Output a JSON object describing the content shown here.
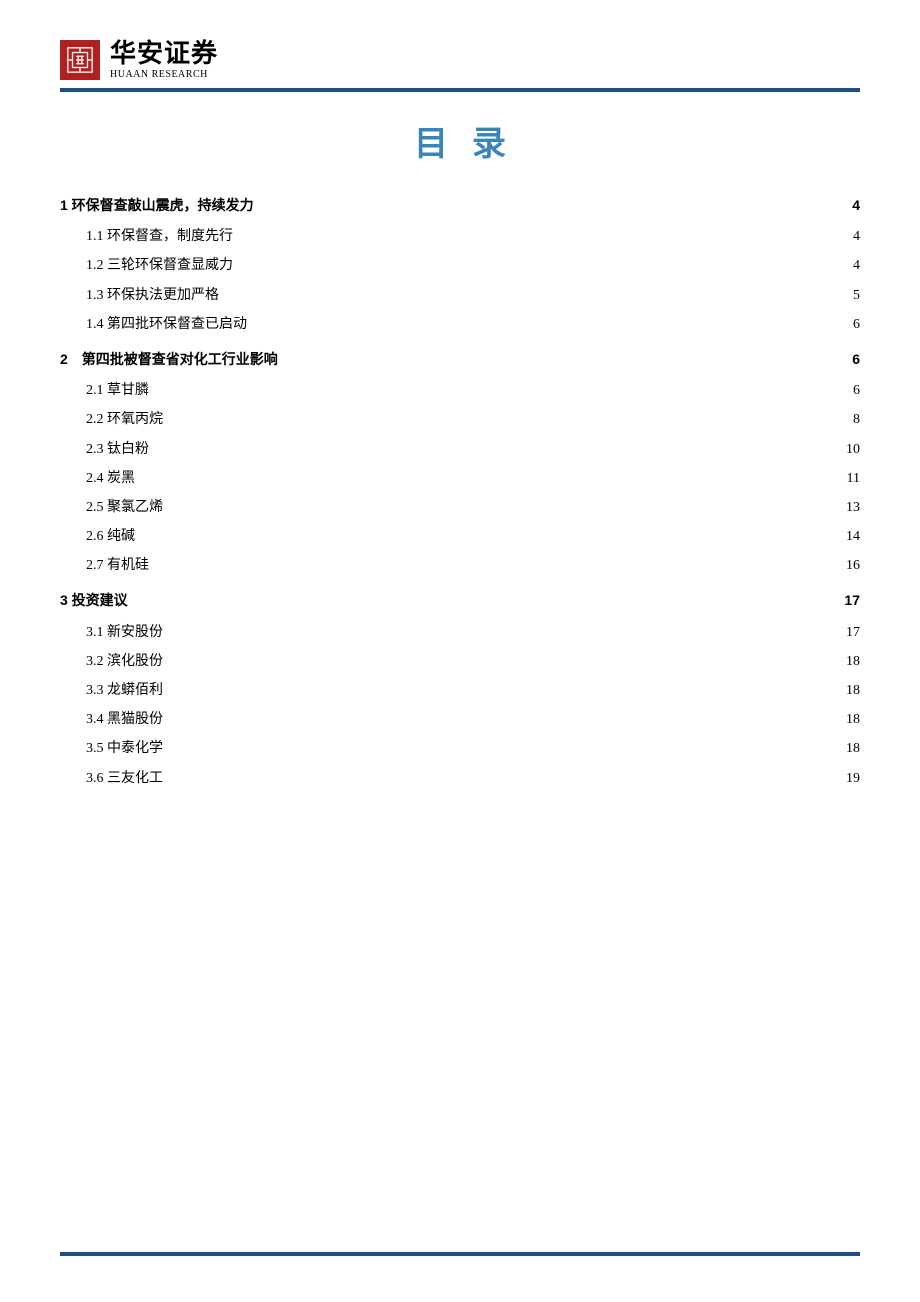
{
  "brand": {
    "cn": "华安证券",
    "en": "HUAAN RESEARCH"
  },
  "title": "目录",
  "toc": [
    {
      "level": 1,
      "label": "1 环保督查敲山震虎，持续发力",
      "page": "4"
    },
    {
      "level": 2,
      "label": "1.1 环保督查，制度先行",
      "page": "4"
    },
    {
      "level": 2,
      "label": "1.2 三轮环保督查显威力",
      "page": "4"
    },
    {
      "level": 2,
      "label": "1.3 环保执法更加严格",
      "page": "5"
    },
    {
      "level": 2,
      "label": "1.4 第四批环保督查已启动",
      "page": "6"
    },
    {
      "level": 1,
      "label": "2　第四批被督查省对化工行业影响",
      "page": "6"
    },
    {
      "level": 2,
      "label": "2.1 草甘膦",
      "page": "6"
    },
    {
      "level": 2,
      "label": "2.2 环氧丙烷",
      "page": "8"
    },
    {
      "level": 2,
      "label": "2.3 钛白粉",
      "page": "10"
    },
    {
      "level": 2,
      "label": "2.4 炭黑",
      "page": "11"
    },
    {
      "level": 2,
      "label": "2.5 聚氯乙烯",
      "page": "13"
    },
    {
      "level": 2,
      "label": "2.6 纯碱",
      "page": "14"
    },
    {
      "level": 2,
      "label": "2.7 有机硅",
      "page": "16"
    },
    {
      "level": 1,
      "label": "3 投资建议",
      "page": "17"
    },
    {
      "level": 2,
      "label": "3.1 新安股份",
      "page": "17"
    },
    {
      "level": 2,
      "label": "3.2 滨化股份",
      "page": "18"
    },
    {
      "level": 2,
      "label": "3.3 龙蟒佰利",
      "page": "18"
    },
    {
      "level": 2,
      "label": "3.4 黑猫股份",
      "page": "18"
    },
    {
      "level": 2,
      "label": "3.5 中泰化学",
      "page": "18"
    },
    {
      "level": 2,
      "label": "3.6 三友化工",
      "page": "19"
    }
  ]
}
